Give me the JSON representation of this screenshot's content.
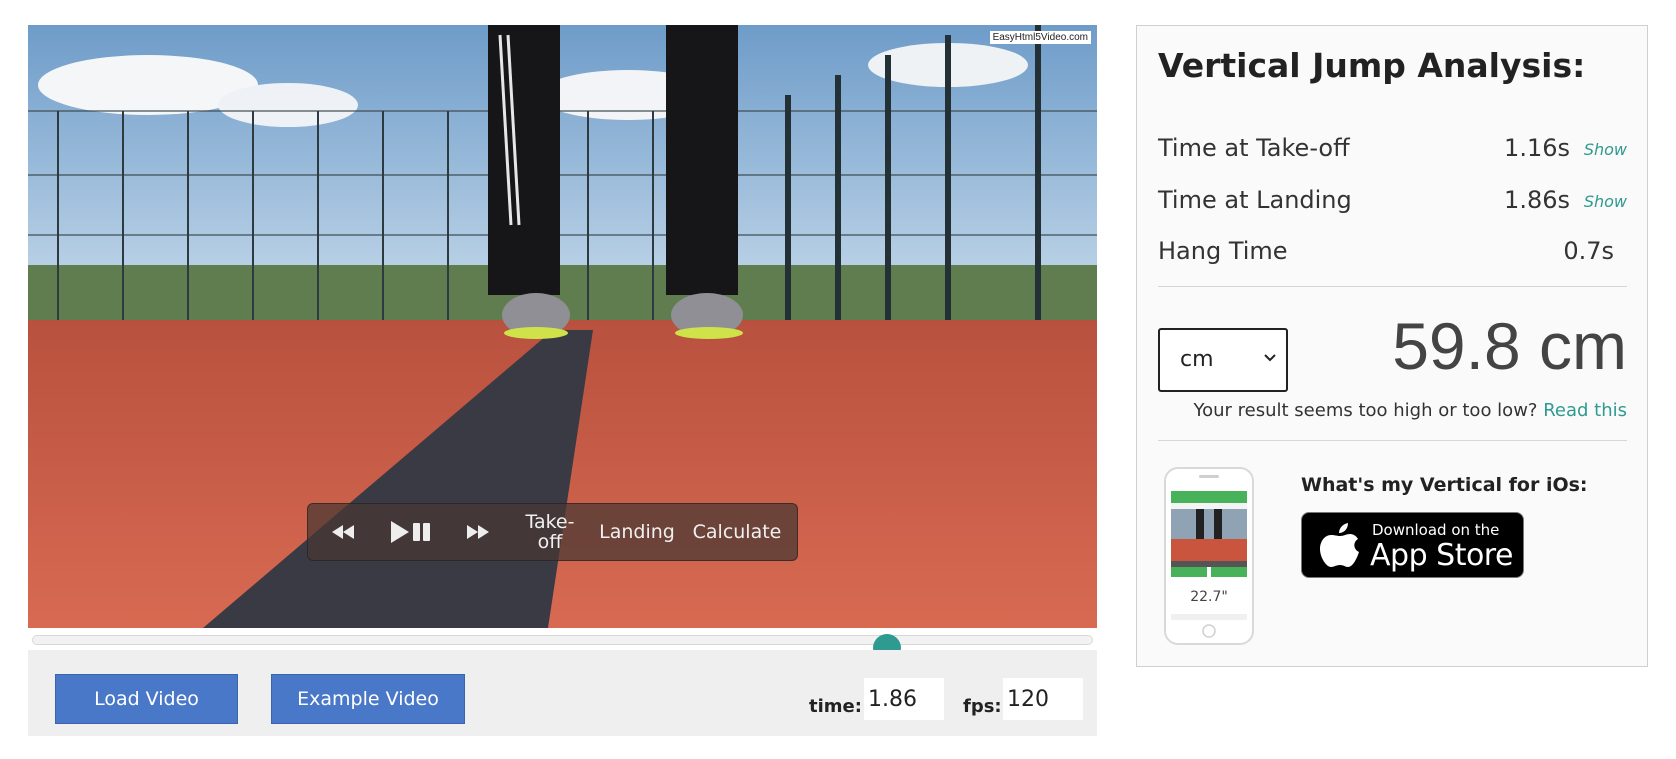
{
  "video": {
    "watermark": "EasyHtml5Video.com",
    "controls": {
      "takeoff_label_1": "Take-",
      "takeoff_label_2": "off",
      "landing_label": "Landing",
      "calculate_label": "Calculate"
    },
    "seek_position": 0.806
  },
  "toolbar": {
    "load_label": "Load Video",
    "example_label": "Example Video",
    "time_label": "time:",
    "time_value": "1.86",
    "fps_label": "fps:",
    "fps_value": "120"
  },
  "panel": {
    "title": "Vertical Jump Analysis:",
    "takeoff_label": "Time at Take-off",
    "takeoff_value": "1.16s",
    "landing_label": "Time at Landing",
    "landing_value": "1.86s",
    "hang_label": "Hang Time",
    "hang_value": "0.7s",
    "show_label": "Show",
    "unit_selected": "cm",
    "result": "59.8 cm",
    "note_text": "Your result seems too high or too low? ",
    "note_link": "Read this",
    "app_heading": "What's my Vertical for iOs:",
    "appstore_line1": "Download on the",
    "appstore_line2": "App Store",
    "phone_screen_value": "22.7\""
  },
  "colors": {
    "accent": "#2f9a90",
    "button": "#4a78c9",
    "track": "#c9553f"
  }
}
